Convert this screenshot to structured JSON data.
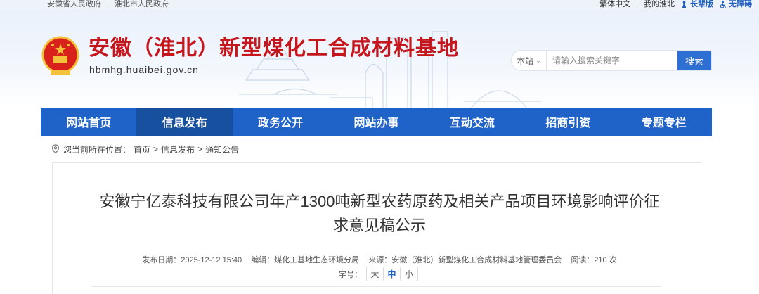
{
  "topbar": {
    "links": [
      "安徽省人民政府",
      "淮北市人民政府"
    ],
    "traditional": "繁体中文",
    "favorite": "我的淮北",
    "elder": "长辈版",
    "accessible": "无障碍"
  },
  "header": {
    "title": "安徽（淮北）新型煤化工合成材料基地",
    "domain": "hbmhg.huaibei.gov.cn",
    "title_color": "#c4161c"
  },
  "search": {
    "scope": "本站",
    "placeholder": "请输入搜索关键字",
    "button": "搜索"
  },
  "nav": {
    "items": [
      "网站首页",
      "信息发布",
      "政务公开",
      "网站办事",
      "互动交流",
      "招商引资",
      "专题专栏"
    ],
    "active_index": 1,
    "color": "#1f63c8"
  },
  "breadcrumb": {
    "prefix": "您当前所在位置：",
    "items": [
      "首页",
      "信息发布",
      "通知公告"
    ],
    "separator": ">"
  },
  "article": {
    "title_line1": "安徽宁亿泰科技有限公司年产1300吨新型农药原药及相关产品项目环境影响评价征",
    "title_line2": "求意见稿公示",
    "published": "发布日期：2025-12-12 15:40",
    "editor": "编辑：煤化工基地生态环境分局",
    "source": "来源：安徽（淮北）新型煤化工合成材料基地管理委员会",
    "views": "阅读：210 次",
    "font_label": "字号：",
    "font_sizes": [
      "大",
      "中",
      "小"
    ],
    "font_active": "中"
  }
}
